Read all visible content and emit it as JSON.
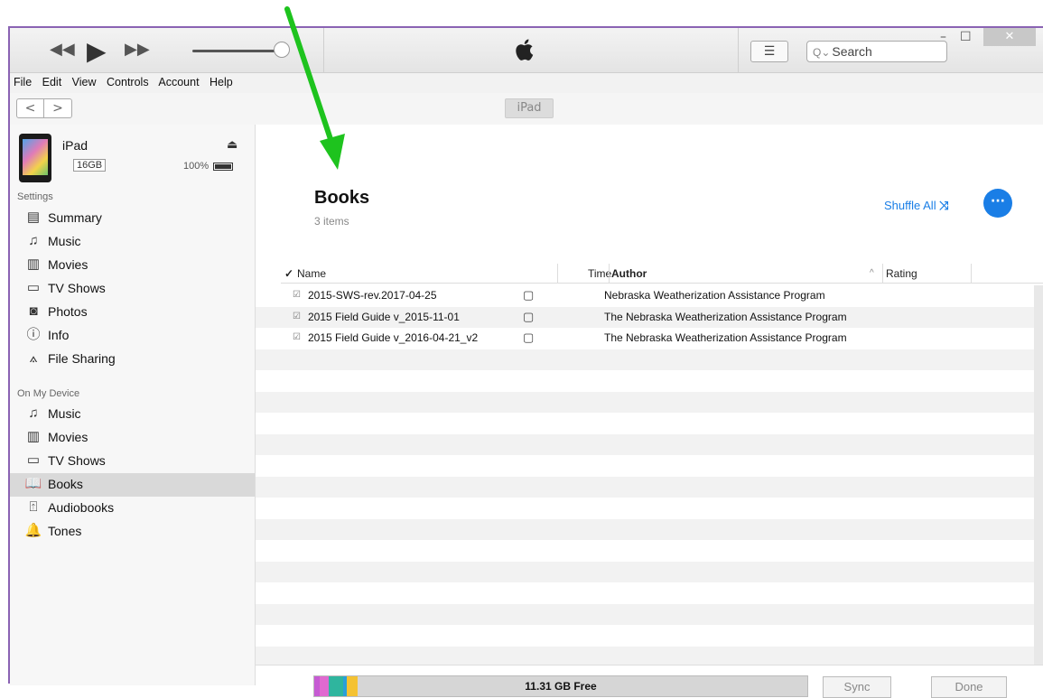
{
  "window": {
    "search_placeholder": "Search",
    "lcd_logo": "apple-logo",
    "list_view_icon": "list-icon"
  },
  "menu": [
    "File",
    "Edit",
    "View",
    "Controls",
    "Account",
    "Help"
  ],
  "nav": {
    "back": "<",
    "forward": ">",
    "device_tab": "iPad"
  },
  "device": {
    "name": "iPad",
    "capacity": "16GB",
    "battery": "100%"
  },
  "sidebar": {
    "settings_title": "Settings",
    "settings_items": [
      {
        "label": "Summary",
        "icon": "summary-icon"
      },
      {
        "label": "Music",
        "icon": "music-note-icon"
      },
      {
        "label": "Movies",
        "icon": "film-icon"
      },
      {
        "label": "TV Shows",
        "icon": "tv-icon"
      },
      {
        "label": "Photos",
        "icon": "camera-icon"
      },
      {
        "label": "Info",
        "icon": "info-icon"
      },
      {
        "label": "File Sharing",
        "icon": "app-store-icon"
      }
    ],
    "device_title": "On My Device",
    "device_items": [
      {
        "label": "Music",
        "icon": "music-note-icon"
      },
      {
        "label": "Movies",
        "icon": "film-icon"
      },
      {
        "label": "TV Shows",
        "icon": "tv-icon"
      },
      {
        "label": "Books",
        "icon": "book-icon",
        "selected": true
      },
      {
        "label": "Audiobooks",
        "icon": "audiobook-icon"
      },
      {
        "label": "Tones",
        "icon": "bell-icon"
      }
    ]
  },
  "main": {
    "title": "Books",
    "count": "3 items",
    "shuffle_label": "Shuffle All",
    "more_label": "···",
    "columns": {
      "check": "✓",
      "name": "Name",
      "time": "Time",
      "author": "Author",
      "rating": "Rating"
    },
    "rows": [
      {
        "name": "2015-SWS-rev.2017-04-25",
        "author": "Nebraska Weatherization Assistance Program"
      },
      {
        "name": "2015 Field Guide v_2015-11-01",
        "author": "The Nebraska Weatherization Assistance Program"
      },
      {
        "name": "2015 Field Guide v_2016-04-21_v2",
        "author": "The Nebraska Weatherization Assistance Program"
      }
    ]
  },
  "footer": {
    "free_space": "11.31 GB Free",
    "sync_label": "Sync",
    "done_label": "Done"
  },
  "colors": {
    "accent": "#1a7ee6",
    "annotation_arrow": "#1ec31e",
    "window_border": "#8a63b3"
  }
}
